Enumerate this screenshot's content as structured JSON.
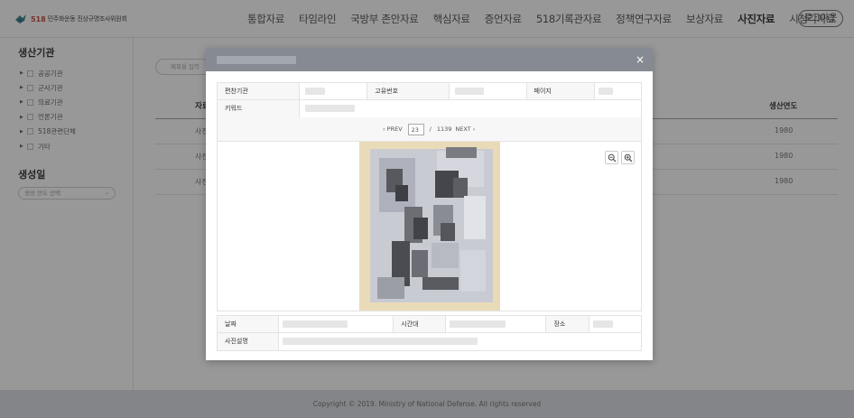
{
  "header": {
    "logo_518": "518",
    "logo_text": "민주화운동 진상규명조사위원회",
    "nav": [
      "통합자료",
      "타임라인",
      "국방부 존안자료",
      "핵심자료",
      "증언자료",
      "518기록관자료",
      "정책연구자료",
      "보상자료",
      "사진자료",
      "시청각자료"
    ],
    "active_nav": "사진자료",
    "logout_label": "로그아웃"
  },
  "sidebar": {
    "section_agency": "생산기관",
    "tree": [
      "공공기관",
      "군사기관",
      "의료기관",
      "언론기관",
      "518관련단체",
      "기타"
    ],
    "section_date": "생성일",
    "year_placeholder": "생성 연도 선택"
  },
  "main": {
    "search_placeholder": "제목을 입력",
    "col_left": "자료",
    "col_year": "생산연도",
    "rows": [
      {
        "left": "사진",
        "year": "1980"
      },
      {
        "left": "사진",
        "year": "1980"
      },
      {
        "left": "사진",
        "year": "1980"
      }
    ]
  },
  "modal": {
    "close_glyph": "×",
    "labels": {
      "agency": "편찬기관",
      "id": "고유번호",
      "page": "페이지",
      "keyword": "키워드",
      "date": "날짜",
      "time": "시간대",
      "place": "장소",
      "desc": "사진설명"
    },
    "pager": {
      "prev": "PREV",
      "current": "23",
      "total": "1139",
      "separator": "/",
      "next": "NEXT"
    },
    "icons": {
      "zoom_out": "zoom-out-icon",
      "zoom_in": "zoom-in-icon"
    }
  },
  "footer": {
    "copyright": "Copyright © 2019. Ministry of National Defense. All rights reserved"
  },
  "colors": {
    "overlay": "#282828",
    "modal_header": "#868b93",
    "footer_bg": "#d9dbe0"
  }
}
